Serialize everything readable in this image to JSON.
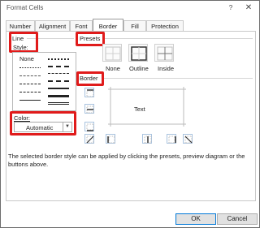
{
  "window": {
    "title": "Format Cells",
    "help_label": "?",
    "close_label": "✕"
  },
  "tabs": [
    {
      "label": "Number"
    },
    {
      "label": "Alignment"
    },
    {
      "label": "Font"
    },
    {
      "label": "Border",
      "active": true
    },
    {
      "label": "Fill"
    },
    {
      "label": "Protection"
    }
  ],
  "line": {
    "heading": "Line",
    "style_label": "Style:",
    "none_label": "None"
  },
  "color": {
    "label": "Color:",
    "value": "Automatic"
  },
  "presets": {
    "heading": "Presets",
    "items": [
      {
        "label": "None",
        "icon": "preset-none-icon"
      },
      {
        "label": "Outline",
        "icon": "preset-outline-icon"
      },
      {
        "label": "Inside",
        "icon": "preset-inside-icon"
      }
    ]
  },
  "border": {
    "heading": "Border",
    "preview_text": "Text"
  },
  "help_text": "The selected border style can be applied by clicking the presets, preview diagram or the buttons above.",
  "buttons": {
    "ok": "OK",
    "cancel": "Cancel"
  },
  "colors": {
    "highlight": "#e01b1b",
    "accent": "#0078d7"
  }
}
